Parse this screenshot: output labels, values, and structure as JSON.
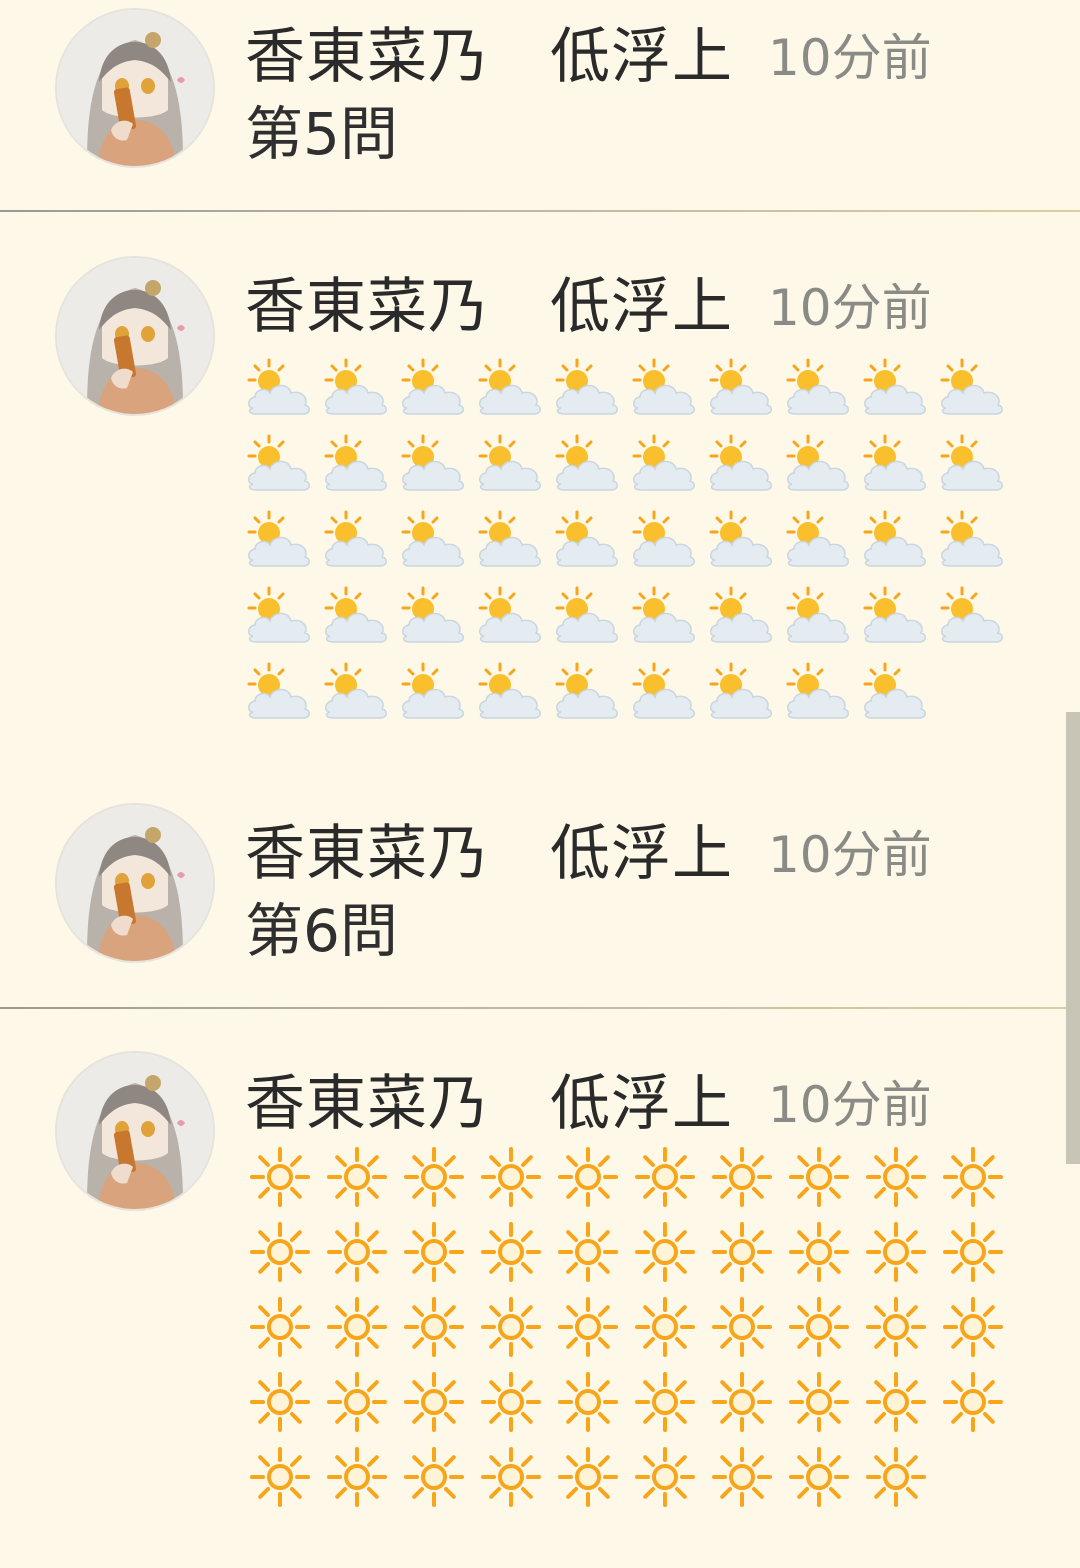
{
  "posts": [
    {
      "name": "香東菜乃　低浮上",
      "time": "10分前",
      "text": "第5問"
    },
    {
      "name": "香東菜乃　低浮上",
      "time": "10分前",
      "emoji_grid": {
        "icon": "sun-behind-cloud-icon",
        "count": 49,
        "per_row": 10
      }
    },
    {
      "name": "香東菜乃　低浮上",
      "time": "10分前",
      "text": "第6問"
    },
    {
      "name": "香東菜乃　低浮上",
      "time": "10分前",
      "emoji_grid": {
        "icon": "sun-icon",
        "count": 49,
        "per_row": 10
      }
    }
  ],
  "colors": {
    "background": "#fdf8e8",
    "name_text": "#2a2a2a",
    "time_text": "#8a8a86",
    "sun": "#f7a51a",
    "cloud": "#e3ecf3"
  }
}
